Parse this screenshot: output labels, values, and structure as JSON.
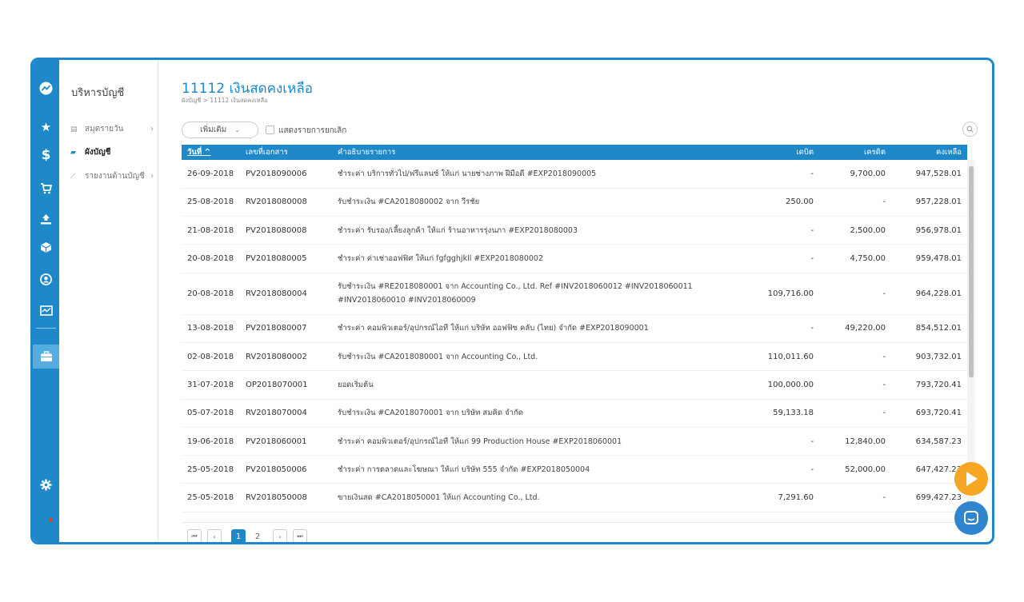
{
  "colors": {
    "accent": "#1e88c8",
    "play": "#f6a623"
  },
  "sidebar": {
    "title": "บริหารบัญชี",
    "items": [
      {
        "label": "สมุดรายวัน",
        "icon": "book-icon"
      },
      {
        "label": "ผังบัญชี",
        "icon": "folder-icon"
      },
      {
        "label": "รายงานด้านบัญชี",
        "icon": "chart-icon"
      }
    ]
  },
  "rail_icons": [
    "dashboard-icon",
    "star-icon",
    "dollar-icon",
    "cart-icon",
    "upload-icon",
    "box-icon",
    "contact-icon",
    "report-icon",
    "briefcase-icon",
    "settings-icon"
  ],
  "page": {
    "title": "11112 เงินสดคงเหลือ",
    "breadcrumb": "ผังบัญชี > 11112 เงินสดคงเหลือ"
  },
  "toolbar": {
    "add_label": "เพิ่มเติม",
    "show_cancelled_label": "แสดงรายการยกเลิก"
  },
  "table": {
    "headers": {
      "date": "วันที่ ^",
      "doc": "เลขที่เอกสาร",
      "desc": "คำอธิบายรายการ",
      "debit": "เดบิต",
      "credit": "เครดิต",
      "balance": "คงเหลือ"
    },
    "rows": [
      {
        "date": "26-09-2018",
        "doc": "PV2018090006",
        "desc": "ชำระค่า บริการทั่วไป/ฟรีแลนซ์ ให้แก่ นายช่างภาพ ฝีมือดี #EXP2018090005",
        "debit": "-",
        "credit": "9,700.00",
        "balance": "947,528.01"
      },
      {
        "date": "25-08-2018",
        "doc": "RV2018080008",
        "desc": "รับชำระเงิน #CA2018080002 จาก วีรชัย",
        "debit": "250.00",
        "credit": "-",
        "balance": "957,228.01"
      },
      {
        "date": "21-08-2018",
        "doc": "PV2018080008",
        "desc": "ชำระค่า รับรอง/เลี้ยงลูกค้า ให้แก่ ร้านอาหารรุ่งนภา #EXP2018080003",
        "debit": "-",
        "credit": "2,500.00",
        "balance": "956,978.01"
      },
      {
        "date": "20-08-2018",
        "doc": "PV2018080005",
        "desc": "ชำระค่า ค่าเช่าออฟฟิศ ให้แก่ fgfgghjkll #EXP2018080002",
        "debit": "-",
        "credit": "4,750.00",
        "balance": "959,478.01"
      },
      {
        "date": "20-08-2018",
        "doc": "RV2018080004",
        "desc": "รับชำระเงิน #RE2018080001 จาก Accounting Co., Ltd. Ref #INV2018060012 #INV2018060011 #INV2018060010 #INV2018060009",
        "debit": "109,716.00",
        "credit": "-",
        "balance": "964,228.01"
      },
      {
        "date": "13-08-2018",
        "doc": "PV2018080007",
        "desc": "ชำระค่า คอมพิวเตอร์/อุปกรณ์ไอที ให้แก่ บริษัท ออฟฟิซ คลับ (ไทย) จำกัด #EXP2018090001",
        "debit": "-",
        "credit": "49,220.00",
        "balance": "854,512.01"
      },
      {
        "date": "02-08-2018",
        "doc": "RV2018080002",
        "desc": "รับชำระเงิน #CA2018080001 จาก Accounting Co., Ltd.",
        "debit": "110,011.60",
        "credit": "-",
        "balance": "903,732.01"
      },
      {
        "date": "31-07-2018",
        "doc": "OP2018070001",
        "desc": "ยอดเริ่มต้น",
        "debit": "100,000.00",
        "credit": "-",
        "balance": "793,720.41"
      },
      {
        "date": "05-07-2018",
        "doc": "RV2018070004",
        "desc": "รับชำระเงิน #CA2018070001 จาก บริษัท สมคิด จำกัด",
        "debit": "59,133.18",
        "credit": "-",
        "balance": "693,720.41"
      },
      {
        "date": "19-06-2018",
        "doc": "PV2018060001",
        "desc": "ชำระค่า คอมพิวเตอร์/อุปกรณ์ไอที ให้แก่ 99 Production House #EXP2018060001",
        "debit": "-",
        "credit": "12,840.00",
        "balance": "634,587.23"
      },
      {
        "date": "25-05-2018",
        "doc": "PV2018050006",
        "desc": "ชำระค่า การตลาดและโฆษณา ให้แก่ บริษัท 555 จำกัด #EXP2018050004",
        "debit": "-",
        "credit": "52,000.00",
        "balance": "647,427.23"
      },
      {
        "date": "25-05-2018",
        "doc": "RV2018050008",
        "desc": "ขายเงินสด #CA2018050001 ให้แก่ Accounting Co., Ltd.",
        "debit": "7,291.60",
        "credit": "-",
        "balance": "699,427.23"
      }
    ]
  },
  "pager": {
    "first": "⏮",
    "prev": "‹",
    "pages": [
      "1",
      "2"
    ],
    "next": "›",
    "last": "⏭"
  }
}
